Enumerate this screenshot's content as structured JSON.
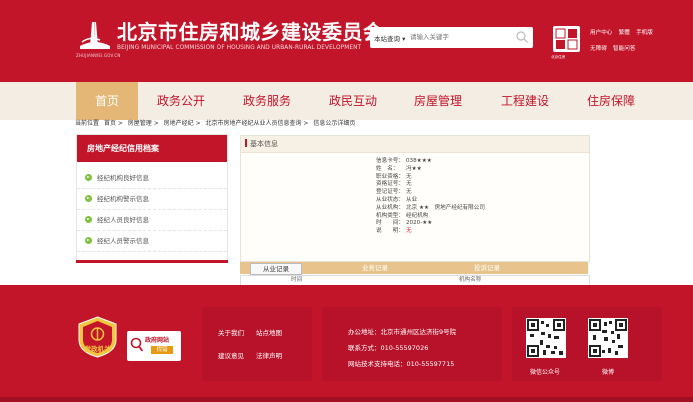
{
  "header": {
    "title": "北京市住房和城乡建设委员会",
    "subtitle": "BEIJING MUNICIPAL COMMISSION OF HOUSING AND URBAN-RURAL DEVELOPMENT",
    "logo_caption": "ZHUJIANWEI.GOV.CN",
    "search_scope": "本站查询 ▾",
    "search_placeholder": "请输入关键字",
    "badge_caption": "北京住房",
    "top_links_row1": [
      "用户中心",
      "繁體",
      "手机版"
    ],
    "top_links_row2": [
      "无障碍",
      "智能问答"
    ]
  },
  "nav": [
    "首页",
    "政务公开",
    "政务服务",
    "政民互动",
    "房屋管理",
    "工程建设",
    "住房保障"
  ],
  "breadcrumb": [
    "当前位置",
    "首页 >",
    "房屋管理 >",
    "房地产经纪 >",
    "北京市房地产经纪从业人员信息查询 >",
    "信息公示详细页"
  ],
  "sidebar": {
    "title": "房地产经纪信用档案",
    "items": [
      "经纪机构良好信息",
      "经纪机构警示信息",
      "经纪人员良好信息",
      "经纪人员警示信息"
    ]
  },
  "content": {
    "title": "基本信息",
    "fields": [
      {
        "label": "信息卡号：",
        "value": "038★★★"
      },
      {
        "label": "姓　名：",
        "value": "冯★★"
      },
      {
        "label": "职业资格：",
        "value": "无"
      },
      {
        "label": "资格证号：",
        "value": "无"
      },
      {
        "label": "登记证号：",
        "value": "无"
      },
      {
        "label": "从业状态：",
        "value": "从业"
      },
      {
        "label": "从业机构：",
        "value": "北京 ★★　房地产经纪有限公司"
      },
      {
        "label": "机构类型：",
        "value": "经纪机构"
      },
      {
        "label": "时　　间：",
        "value": "2020-★★"
      },
      {
        "label": "说　　明：",
        "value": "无"
      }
    ]
  },
  "tabs": [
    "从业记录",
    "业务记录",
    "投诉记录"
  ],
  "table_headers": [
    "时间",
    "机构名称"
  ],
  "footer": {
    "badge_text": "党政机关",
    "site_text": "政府网站",
    "site_sub": "找错",
    "links": [
      "关于我们",
      "站点地图",
      "建议意见",
      "法律声明"
    ],
    "address": "办公地址：北京市通州区达济街9号院",
    "contact": "联系方式：010-55597026",
    "support": "网站技术支持电话：010-55597715",
    "qr1_caption": "微信公众号",
    "qr2_caption": "微博"
  },
  "colors": {
    "brand": "#c2152a",
    "accent": "#e5b777",
    "nav_bg": "#f4ede4"
  }
}
